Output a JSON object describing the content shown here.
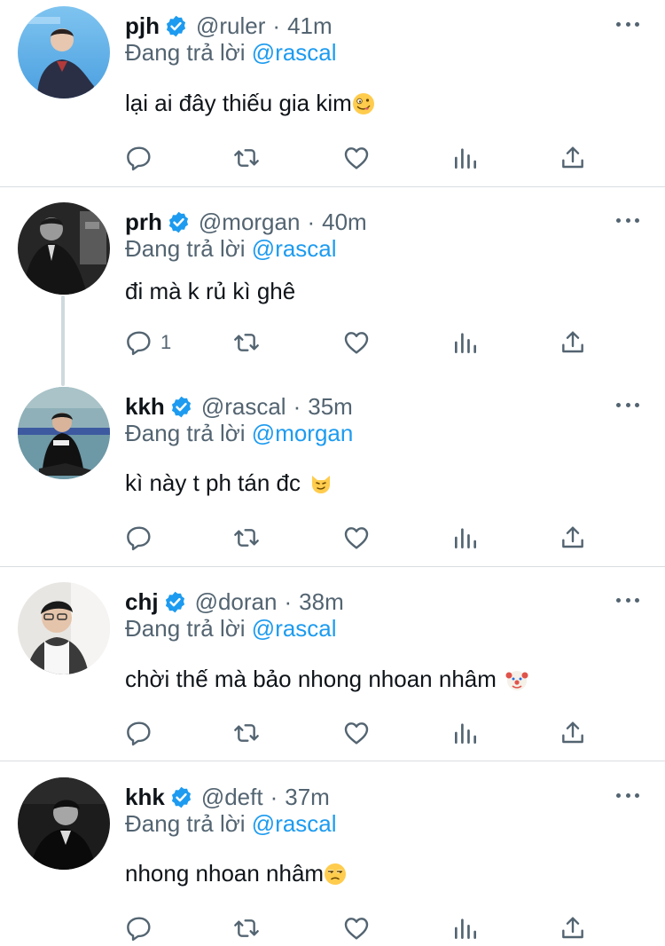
{
  "reply_prefix": "Đang trả lời",
  "colors": {
    "accent": "#1d9bf0",
    "text": "#0f1419",
    "muted": "#536471",
    "divider": "#d9dde1"
  },
  "tweets": [
    {
      "name": "pjh",
      "handle": "@ruler",
      "dot": "·",
      "time": "41m",
      "reply_to": "@rascal",
      "text": "lại ai đây thiếu gia kim",
      "emoji": "zany-face",
      "reply_count": ""
    },
    {
      "name": "prh",
      "handle": "@morgan",
      "dot": "·",
      "time": "40m",
      "reply_to": "@rascal",
      "text": "đi mà k rủ kì ghê",
      "emoji": "",
      "reply_count": "1"
    },
    {
      "name": "kkh",
      "handle": "@rascal",
      "dot": "·",
      "time": "35m",
      "reply_to": "@morgan",
      "text": "kì này t ph tán đc",
      "emoji": "smirk-cat",
      "reply_count": ""
    },
    {
      "name": "chj",
      "handle": "@doran",
      "dot": "·",
      "time": "38m",
      "reply_to": "@rascal",
      "text": "chời thế mà bảo nhong nhoan nhâm",
      "emoji": "clown-face",
      "reply_count": ""
    },
    {
      "name": "khk",
      "handle": "@deft",
      "dot": "·",
      "time": "37m",
      "reply_to": "@rascal",
      "text": "nhong nhoan nhâm",
      "emoji": "unamused-face",
      "reply_count": ""
    }
  ],
  "icons": {
    "reply": "reply-icon",
    "retweet": "retweet-icon",
    "like": "heart-icon",
    "views": "analytics-icon",
    "share": "share-icon",
    "more": "more-icon",
    "verified": "verified-badge-icon"
  }
}
